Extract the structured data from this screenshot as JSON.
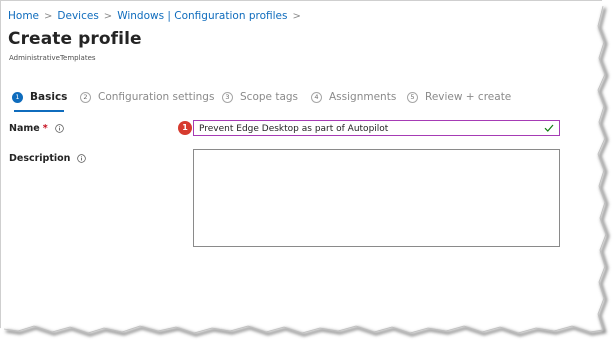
{
  "breadcrumb": {
    "items": [
      "Home",
      "Devices",
      "Windows | Configuration profiles"
    ],
    "separator": ">"
  },
  "page": {
    "title": "Create profile",
    "subtitle": "AdministrativeTemplates"
  },
  "tabs": [
    {
      "step": "1",
      "label": "Basics",
      "active": true
    },
    {
      "step": "2",
      "label": "Configuration settings",
      "active": false
    },
    {
      "step": "3",
      "label": "Scope tags",
      "active": false
    },
    {
      "step": "4",
      "label": "Assignments",
      "active": false
    },
    {
      "step": "5",
      "label": "Review + create",
      "active": false
    }
  ],
  "form": {
    "name": {
      "label": "Name",
      "required_mark": "*",
      "value": "Prevent Edge Desktop as part of Autopilot",
      "valid": true
    },
    "description": {
      "label": "Description",
      "value": ""
    }
  },
  "callout": {
    "number": "1"
  },
  "colors": {
    "accent": "#0f6cbd",
    "focus_border": "#a63bb5",
    "valid_check": "#107c10",
    "callout": "#d63b2f",
    "required": "#c50f1f"
  },
  "icons": {
    "info": "info-icon",
    "valid": "checkmark-icon"
  }
}
